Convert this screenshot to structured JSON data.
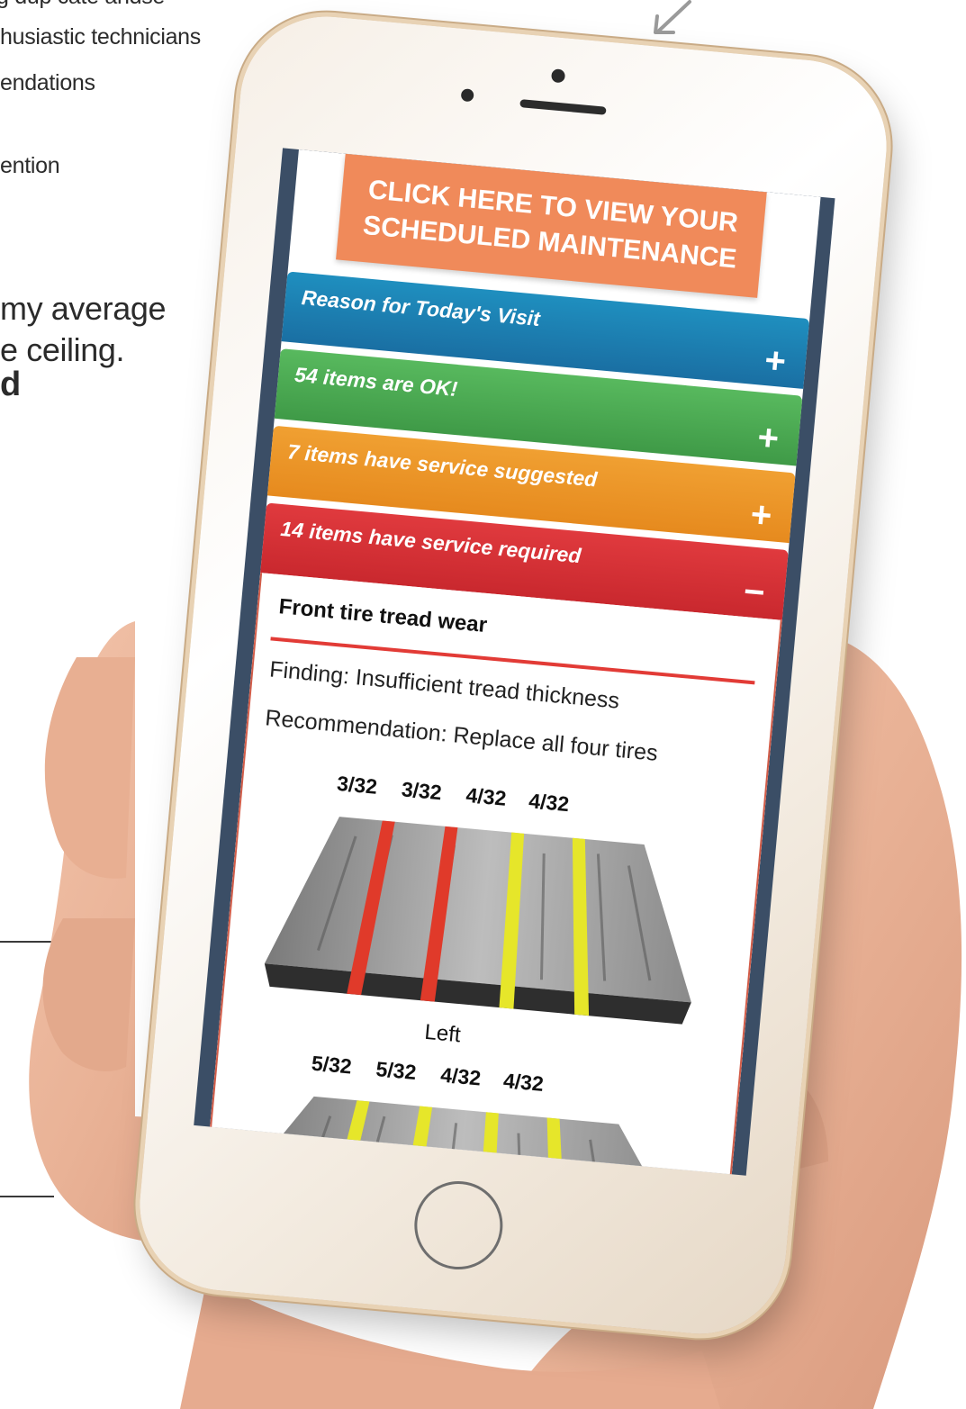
{
  "background_text": {
    "lines": [
      "g dup cate andse",
      "husiastic technicians",
      "endations",
      "ention",
      "my average",
      "e ceiling.",
      "d"
    ]
  },
  "phone_screen": {
    "cta_line1": "CLICK HERE TO VIEW YOUR",
    "cta_line2": "SCHEDULED MAINTENANCE",
    "sections": [
      {
        "label": "Reason for Today's Visit",
        "toggle": "+",
        "color": "#1f8fbf"
      },
      {
        "label": "54 items are OK!",
        "toggle": "+",
        "color": "#58b95e"
      },
      {
        "label": "7 items have service suggested",
        "toggle": "+",
        "color": "#f0a032"
      },
      {
        "label": "14 items have service required",
        "toggle": "−",
        "color": "#e03a3e"
      }
    ],
    "expanded_item": {
      "title": "Front tire tread wear",
      "finding": "Finding: Insufficient tread thickness",
      "recommendation": "Recommendation: Replace all four tires",
      "left_tire": {
        "measurements": [
          "3/32",
          "3/32",
          "4/32",
          "4/32"
        ],
        "groove_colors": [
          "#e03a2a",
          "#e03a2a",
          "#e6e62a",
          "#e6e62a"
        ],
        "label": "Left"
      },
      "right_tire": {
        "measurements": [
          "5/32",
          "5/32",
          "4/32",
          "4/32"
        ],
        "groove_colors": [
          "#e6e62a",
          "#e6e62a",
          "#e6e62a",
          "#e6e62a"
        ]
      }
    }
  },
  "icons": [
    "arrow-down-left-icon",
    "plus-icon",
    "minus-icon",
    "home-button-icon"
  ]
}
